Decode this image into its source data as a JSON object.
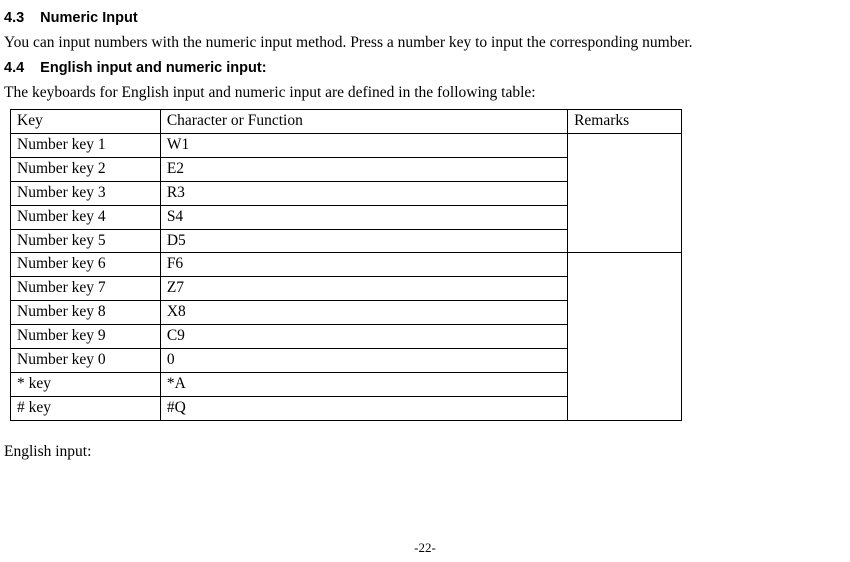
{
  "section43": {
    "num": "4.3",
    "title": "Numeric Input",
    "body": "You can input numbers with the numeric input method. Press a number key to input the corresponding number."
  },
  "section44": {
    "num": "4.4",
    "title": "English input and numeric input:",
    "intro": "The keyboards for English input and numeric input are defined in the following table:"
  },
  "table": {
    "headers": {
      "key": "Key",
      "char": "Character or Function",
      "remarks": "Remarks"
    },
    "rows": [
      {
        "key": "Number key 1",
        "char": "W1"
      },
      {
        "key": "Number key 2",
        "char": "E2"
      },
      {
        "key": "Number key 3",
        "char": "R3"
      },
      {
        "key": "Number key 4",
        "char": "S4"
      },
      {
        "key": "Number key 5",
        "char": "D5"
      },
      {
        "key": "Number key 6",
        "char": "F6"
      },
      {
        "key": "Number key 7",
        "char": "Z7"
      },
      {
        "key": "Number key 8",
        "char": "X8"
      },
      {
        "key": "Number key 9",
        "char": "C9"
      },
      {
        "key": "Number key 0",
        "char": "0"
      },
      {
        "key": "* key",
        "char": "*A"
      },
      {
        "key": "# key",
        "char": "#Q"
      }
    ]
  },
  "postTable": "English input:",
  "pageNumber": "-22-"
}
